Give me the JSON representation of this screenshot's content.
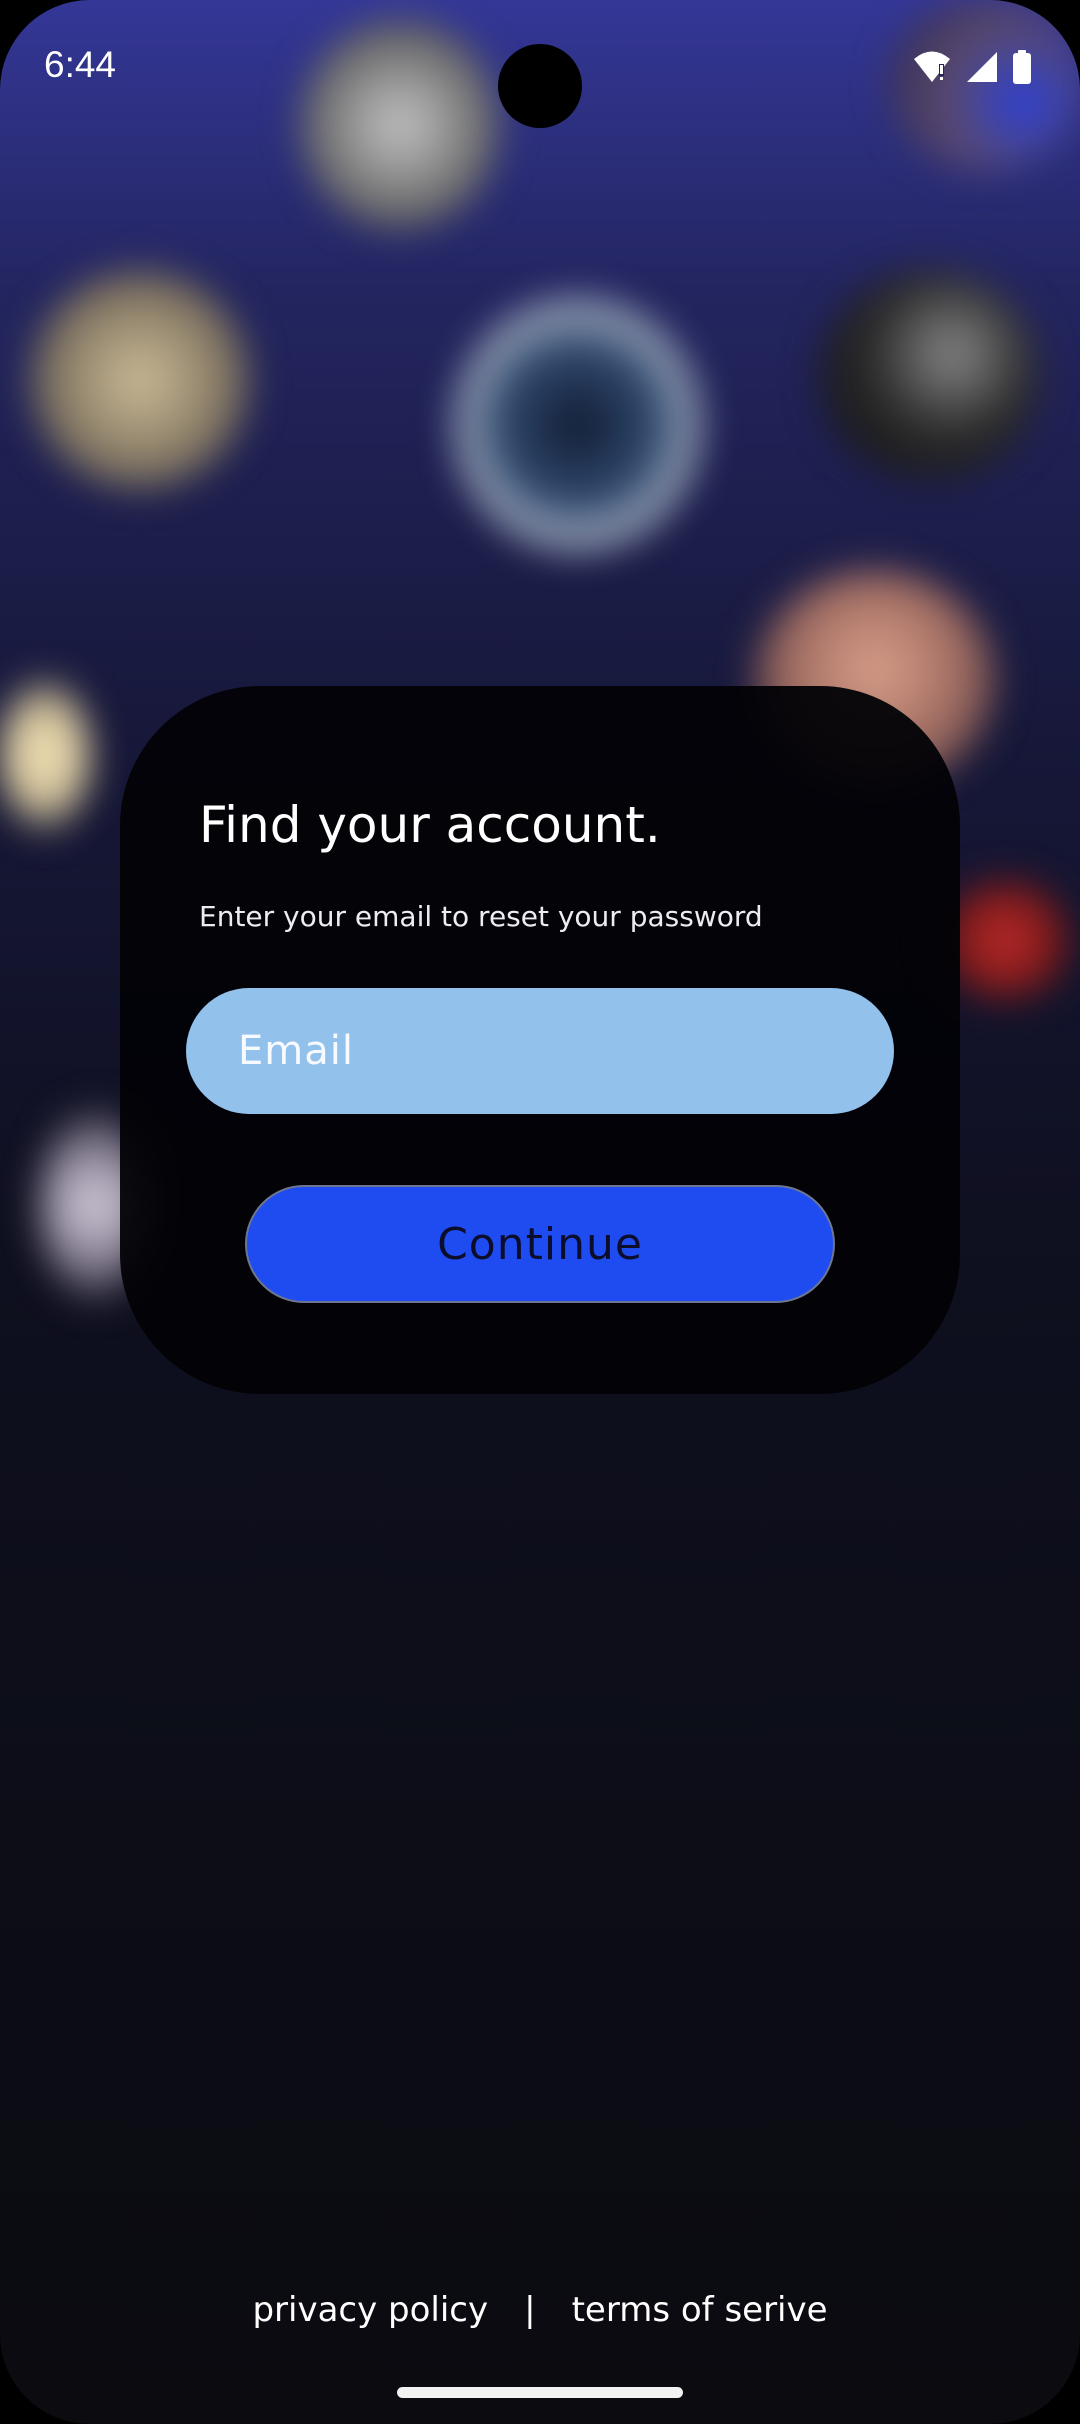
{
  "status_bar": {
    "time": "6:44",
    "icons": [
      "wifi-alert-icon",
      "cellular-signal-icon",
      "battery-icon"
    ]
  },
  "card": {
    "title": "Find your account.",
    "subtitle": "Enter your email to reset your password",
    "email_placeholder": "Email",
    "email_value": "",
    "continue_label": "Continue"
  },
  "footer": {
    "privacy_label": "privacy policy",
    "separator": "|",
    "terms_label": "terms of serive"
  },
  "colors": {
    "background_top": "#343797",
    "background_bottom": "#0b0b10",
    "card_background": "#020206",
    "email_field": "#92c1ec",
    "continue_button": "#1f4cf0",
    "continue_text": "#0b0d2a"
  }
}
